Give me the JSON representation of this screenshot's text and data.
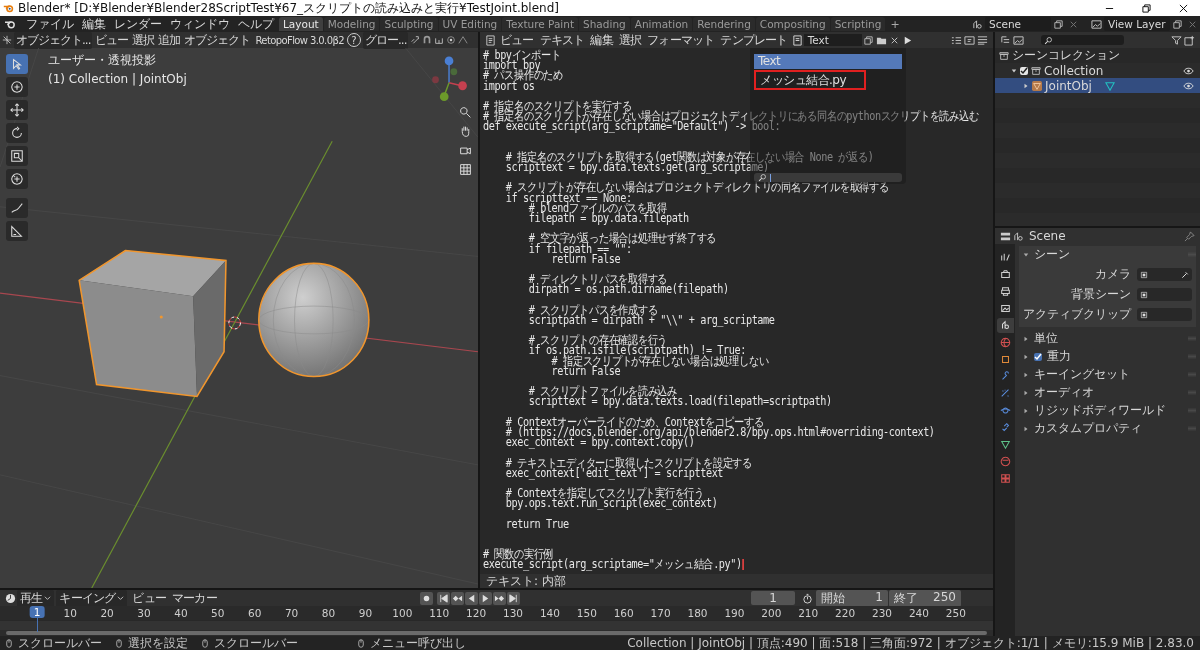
{
  "window": {
    "title": "Blender* [D:¥Blender¥Blender28ScriptTest¥67_スクリプトの読み込みと実行¥TestJoint.blend]"
  },
  "menu": [
    "ファイル",
    "編集",
    "レンダー",
    "ウィンドウ",
    "ヘルプ"
  ],
  "workspaces": [
    {
      "label": "Layout",
      "selected": true
    },
    {
      "label": "Modeling",
      "selected": false
    },
    {
      "label": "Sculpting",
      "selected": false
    },
    {
      "label": "UV Editing",
      "selected": false
    },
    {
      "label": "Texture Paint",
      "selected": false
    },
    {
      "label": "Shading",
      "selected": false
    },
    {
      "label": "Animation",
      "selected": false
    },
    {
      "label": "Rendering",
      "selected": false
    },
    {
      "label": "Compositing",
      "selected": false
    },
    {
      "label": "Scripting",
      "selected": false
    }
  ],
  "add_workspace": "+",
  "scene": "Scene",
  "view_layer": "View Layer",
  "viewport": {
    "mode": "オブジェクト...",
    "menus": [
      "ビュー",
      "選択",
      "追加",
      "オブジェクト"
    ],
    "addon": "RetopoFlow 3.0.0β2",
    "help": "?",
    "orientation": "グロー...",
    "view_name": "ユーザー・透視投影",
    "context": "(1) Collection | JointObj",
    "tools": [
      {
        "selected": true
      },
      {
        "selected": false
      },
      {
        "selected": false
      },
      {
        "selected": false
      },
      {
        "selected": false
      },
      {
        "selected": false
      },
      {
        "selected": false
      },
      {
        "selected": false
      }
    ]
  },
  "text_editor": {
    "menus": [
      "ビュー",
      "テキスト",
      "編集",
      "選択",
      "フォーマット",
      "テンプレート"
    ],
    "text_name": "Text",
    "footer": "テキスト: 内部",
    "paragraphs": [
      {
        "wide_gap": false,
        "lines": [
          "# bpyインポート",
          "import bpy",
          "# パス操作のため",
          "import os"
        ]
      },
      {
        "wide_gap": true,
        "lines": [
          "# 指定名のスクリプトを実行する",
          "# 指定名のスクリプトが存在しない場合はプロジェクトディレクトリにある同名のpythonスクリプトを読み込む",
          "def execute_script(arg_scriptame=\"Default\") -> bool:"
        ]
      },
      {
        "wide_gap": false,
        "lines": [
          "    # 指定名のスクリプトを取得する(get関数は対象が存在しない場合 None が返る)",
          "    scripttext = bpy.data.texts.get(arg_scriptame)"
        ]
      },
      {
        "wide_gap": false,
        "lines": [
          "    # スクリプトが存在しない場合はプロジェクトディレクトリの同名ファイルを取得する",
          "    if scripttext == None:",
          "        # blendファイルのパスを取得",
          "        filepath = bpy.data.filepath"
        ]
      },
      {
        "wide_gap": false,
        "lines": [
          "        # 空文字が返った場合は処理せず終了する",
          "        if filepath == \"\":",
          "            return False"
        ]
      },
      {
        "wide_gap": false,
        "lines": [
          "        # ディレクトリパスを取得する",
          "        dirpath = os.path.dirname(filepath)"
        ]
      },
      {
        "wide_gap": false,
        "lines": [
          "        # スクリプトパスを作成する",
          "        scriptpath = dirpath + \"\\\\\" + arg_scriptame"
        ]
      },
      {
        "wide_gap": false,
        "lines": [
          "        # スクリプトの存在確認を行う",
          "        if os.path.isfile(scriptpath) != True:",
          "            # 指定スクリプトが存在しない場合は処理しない",
          "            return False"
        ]
      },
      {
        "wide_gap": false,
        "lines": [
          "        # スクリプトファイルを読み込み",
          "        scripttext = bpy.data.texts.load(filepath=scriptpath)"
        ]
      },
      {
        "wide_gap": false,
        "lines": [
          "    # Contextオーバーライドのため、Contextをコピーする",
          "    # (https://docs.blender.org/api/blender2.8/bpy.ops.html#overriding-context)",
          "    exec_context = bpy.context.copy()"
        ]
      },
      {
        "wide_gap": false,
        "lines": [
          "    # テキストエディターに取得したスクリプトを設定する",
          "    exec_context['edit_text'] = scripttext"
        ]
      },
      {
        "wide_gap": false,
        "lines": [
          "    # Contextを指定してスクリプト実行を行う",
          "    bpy.ops.text.run_script(exec_context)"
        ]
      },
      {
        "wide_gap": true,
        "lines": [
          "    return True"
        ]
      },
      {
        "wide_gap": false,
        "lines": [
          "# 関数の実行例",
          "execute_script(arg_scriptame=\"メッシュ結合.py\")"
        ]
      }
    ],
    "dropdown": {
      "items": [
        {
          "label": "Text",
          "selected": true,
          "marked": false
        },
        {
          "label": "メッシュ結合.py",
          "selected": false,
          "marked": true
        }
      ]
    }
  },
  "outliner": {
    "items": [
      {
        "label": "シーンコレクション",
        "kind": "scene-collection",
        "selected": false,
        "children": [
          {
            "label": "Collection",
            "kind": "collection",
            "selected": false,
            "expanded": true,
            "checked": true,
            "children": [
              {
                "label": "JointObj",
                "kind": "object",
                "selected": true,
                "expanded": false
              }
            ]
          }
        ]
      }
    ]
  },
  "properties": {
    "context": "Scene",
    "tabs": [
      {
        "selected": false
      },
      {
        "selected": false
      },
      {
        "selected": false
      },
      {
        "selected": false
      },
      {
        "selected": true
      },
      {
        "selected": false
      },
      {
        "selected": false
      },
      {
        "selected": false
      },
      {
        "selected": false
      },
      {
        "selected": false
      },
      {
        "selected": false
      },
      {
        "selected": false
      },
      {
        "selected": false
      },
      {
        "selected": false
      }
    ],
    "panels": [
      {
        "title": "シーン",
        "kind": "plain",
        "expanded": true,
        "fields": [
          {
            "label": "カメラ"
          },
          {
            "label": "背景シーン"
          },
          {
            "label": "アクティブクリップ"
          }
        ]
      },
      {
        "title": "単位",
        "kind": "plain",
        "expanded": false
      },
      {
        "title": "重力",
        "kind": "toggle",
        "expanded": false,
        "checked": true
      },
      {
        "title": "キーイングセット",
        "kind": "plain",
        "expanded": false
      },
      {
        "title": "オーディオ",
        "kind": "plain",
        "expanded": false
      },
      {
        "title": "リジッドボディワールド",
        "kind": "plain",
        "expanded": false
      },
      {
        "title": "カスタムプロパティ",
        "kind": "plain",
        "expanded": false
      }
    ]
  },
  "timeline": {
    "menus": [
      {
        "label": "再生",
        "kind": "dropdown"
      },
      {
        "label": "キーイング",
        "kind": "dropdown"
      },
      {
        "label": "ビュー",
        "kind": "menu"
      },
      {
        "label": "マーカー",
        "kind": "menu"
      }
    ],
    "current_frame": "1",
    "start_label": "開始",
    "start": "1",
    "end_label": "終了",
    "end": "250",
    "playhead": "1",
    "ticks": [
      "10",
      "20",
      "30",
      "40",
      "50",
      "60",
      "70",
      "80",
      "90",
      "100",
      "110",
      "120",
      "130",
      "140",
      "150",
      "160",
      "170",
      "180",
      "190",
      "200",
      "210",
      "220",
      "230",
      "240",
      "250"
    ]
  },
  "status_bar": {
    "hints": [
      "スクロールバー",
      "選択を設定",
      "スクロールバー",
      "メニュー呼び出し"
    ],
    "stats": "Collection | JointObj | 頂点:490 | 面:518 | 三角面:972 | オブジェクト:1/1 | メモリ:15.9 MiB | 2.83.0"
  }
}
